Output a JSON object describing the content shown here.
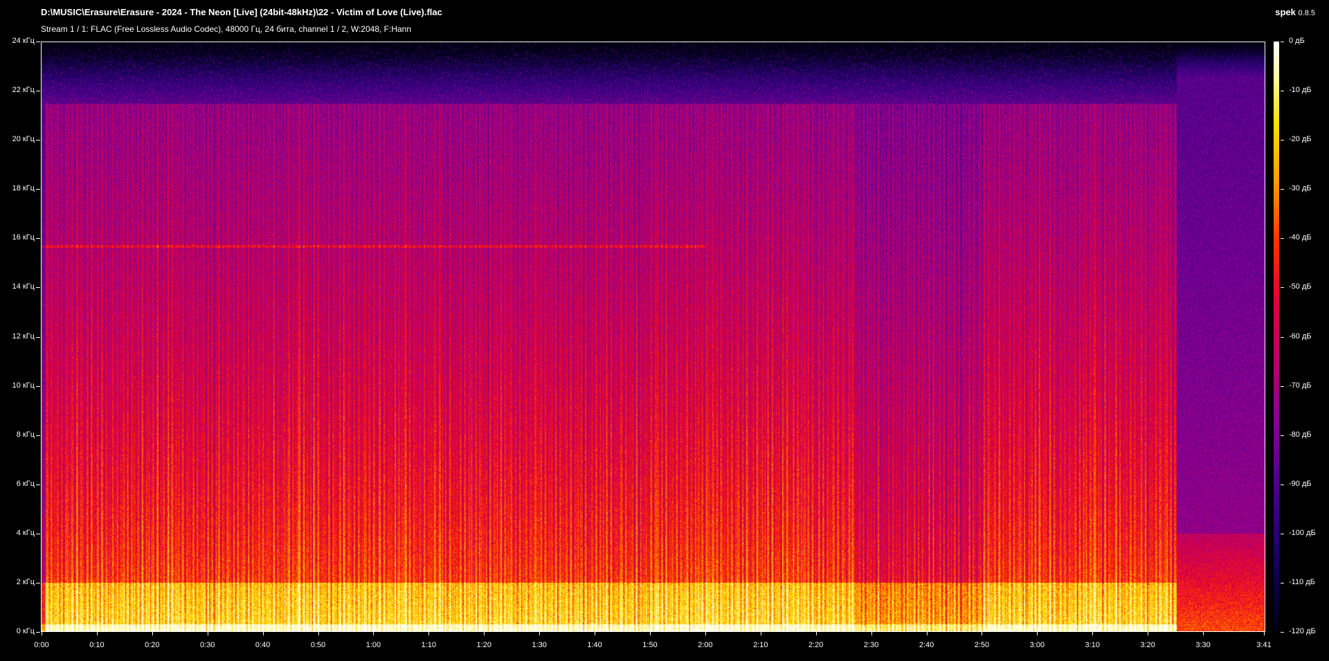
{
  "window": {
    "title": "D:\\MUSIC\\Erasure\\Erasure - 2024 -  The Neon [Live] (24bit-48kHz)\\22 - Victim of Love (Live).flac",
    "subtitle": "Stream 1 / 1: FLAC (Free Lossless Audio Codec), 48000 Гц, 24 бита, channel 1 / 2, W:2048, F:Hann",
    "app_name": "spek",
    "app_version": "0.8.5"
  },
  "chart_data": {
    "type": "heatmap",
    "title": "",
    "xlabel": "",
    "ylabel": "",
    "x_ticks": [
      "0:00",
      "0:10",
      "0:20",
      "0:30",
      "0:40",
      "0:50",
      "1:00",
      "1:10",
      "1:20",
      "1:30",
      "1:40",
      "1:50",
      "2:00",
      "2:10",
      "2:20",
      "2:30",
      "2:40",
      "2:50",
      "3:00",
      "3:10",
      "3:20",
      "3:30",
      "3:41"
    ],
    "x_tick_seconds": [
      0,
      10,
      20,
      30,
      40,
      50,
      60,
      70,
      80,
      90,
      100,
      110,
      120,
      130,
      140,
      150,
      160,
      170,
      180,
      190,
      200,
      210,
      221
    ],
    "duration_seconds": 221,
    "y_ticks": [
      "0 кГц",
      "2 кГц",
      "4 кГц",
      "6 кГц",
      "8 кГц",
      "10 кГц",
      "12 кГц",
      "14 кГц",
      "16 кГц",
      "18 кГц",
      "20 кГц",
      "22 кГц",
      "24 кГц"
    ],
    "y_tick_khz": [
      0,
      2,
      4,
      6,
      8,
      10,
      12,
      14,
      16,
      18,
      20,
      22,
      24
    ],
    "ylim_khz": [
      0,
      24
    ],
    "colorbar_ticks": [
      "0 дБ",
      "-10 дБ",
      "-20 дБ",
      "-30 дБ",
      "-40 дБ",
      "-50 дБ",
      "-60 дБ",
      "-70 дБ",
      "-80 дБ",
      "-90 дБ",
      "-100 дБ",
      "-110 дБ",
      "-120 дБ"
    ],
    "colorbar_db": [
      0,
      -10,
      -20,
      -30,
      -40,
      -50,
      -60,
      -70,
      -80,
      -90,
      -100,
      -110,
      -120
    ],
    "colorbar_range_db": [
      -120,
      0
    ],
    "colormap": [
      "#000010",
      "#250070",
      "#52008c",
      "#860090",
      "#b8006a",
      "#e0003a",
      "#ff3000",
      "#ff9a00",
      "#ffe000",
      "#fff9a0",
      "#ffffff"
    ],
    "highlights": {
      "cutoff_khz_main": 21.5,
      "outro_start_seconds": 205,
      "outro_cutoff_khz": 22.5,
      "quiet_section_seconds": [
        147,
        170
      ]
    }
  }
}
